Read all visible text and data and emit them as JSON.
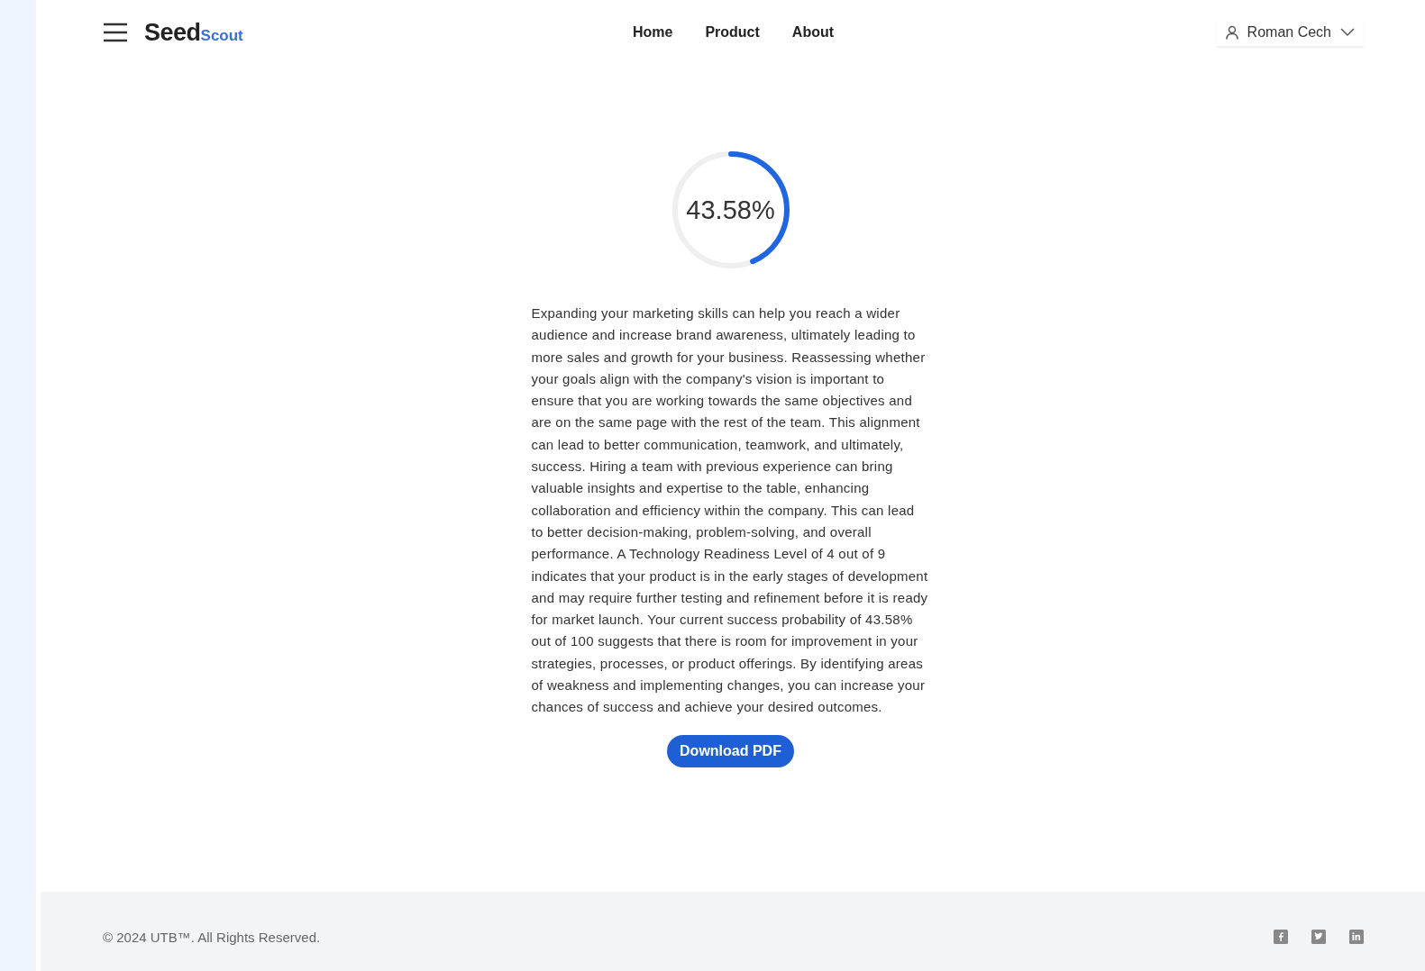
{
  "header": {
    "logo": {
      "main": "Seed",
      "sub": "Scout"
    },
    "nav": [
      {
        "label": "Home"
      },
      {
        "label": "Product"
      },
      {
        "label": "About"
      }
    ],
    "user": {
      "name": "Roman Cech"
    }
  },
  "result": {
    "level": 0.4358,
    "reading": "43.58%",
    "text": "Expanding your marketing skills can help you reach a wider audience and increase brand awareness, ultimately leading to more sales and growth for your business. Reassessing whether your goals align with the company's vision is important to ensure that you are working towards the same objectives and are on the same page with the rest of the team. This alignment can lead to better communication, teamwork, and ultimately, success. Hiring a team with previous experience can bring valuable insights and expertise to the table, enhancing collaboration and efficiency within the company. This can lead to better decision-making, problem-solving, and overall performance. A Technology Readiness Level of 4 out of 9 indicates that your product is in the early stages of development and may require further testing and refinement before it is ready for market launch. Your current success probability of 43.58% out of 100 suggests that there is room for improvement in your strategies, processes, or product offerings. By identifying areas of weakness and implementing changes, you can increase your chances of success and achieve your desired outcomes.",
    "button": "Download PDF"
  },
  "footer": {
    "copyright": "© 2024 UTB™. All Rights Reserved.",
    "social": [
      {
        "kind": "facebook"
      },
      {
        "kind": "twitter"
      },
      {
        "kind": "linkedin"
      }
    ]
  }
}
